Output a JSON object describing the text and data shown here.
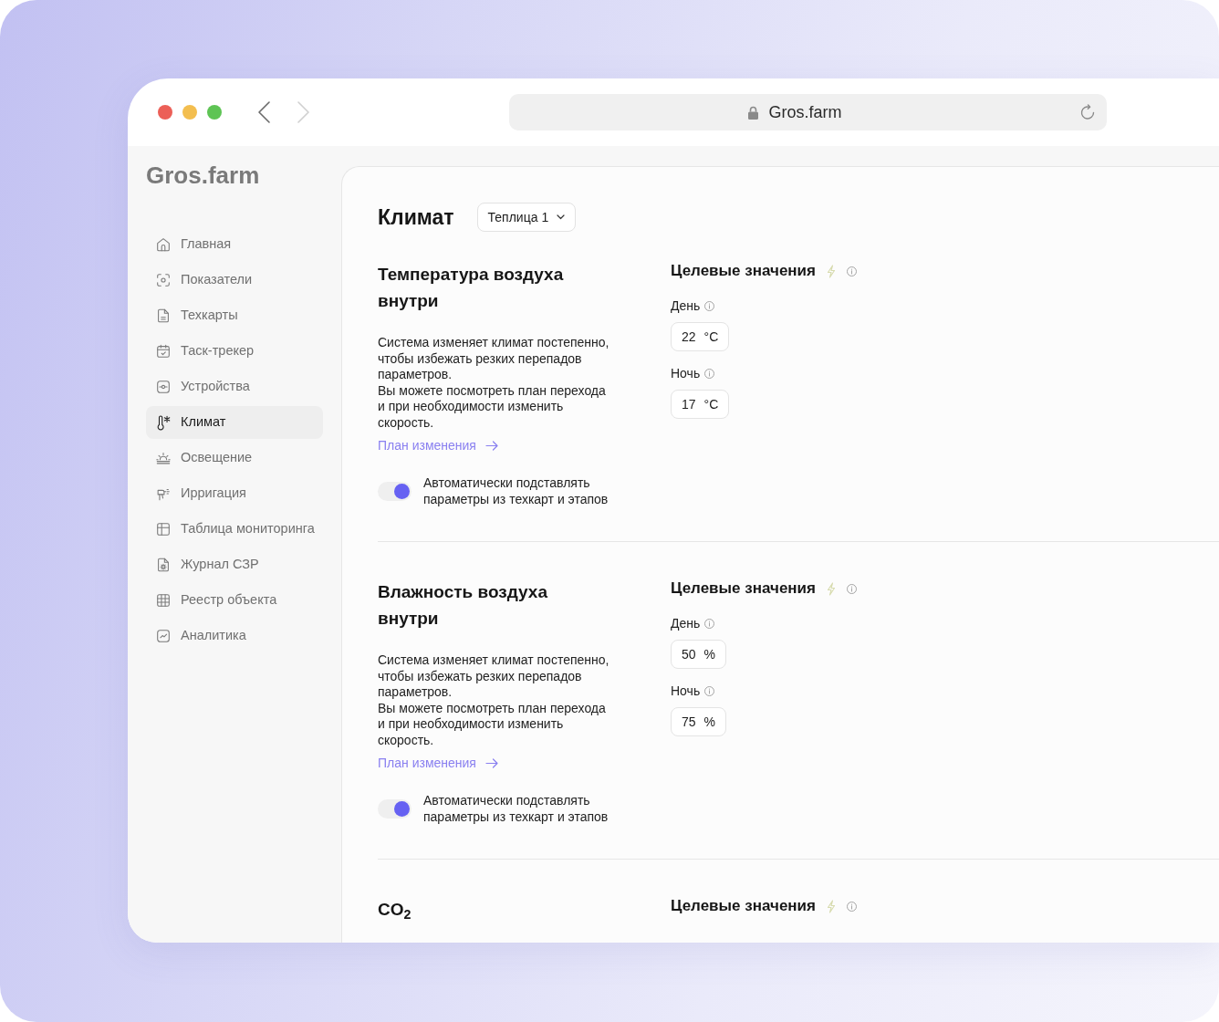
{
  "browser": {
    "navigation": [
      {
        "kind": "back",
        "disabled": false
      },
      {
        "kind": "forward",
        "disabled": true
      }
    ],
    "url": "Gros.farm"
  },
  "sidebar": {
    "logo": "Gros.farm",
    "items": [
      {
        "label": "Главная",
        "selected": false
      },
      {
        "label": "Показатели",
        "selected": false
      },
      {
        "label": "Техкарты",
        "selected": false
      },
      {
        "label": "Таск-трекер",
        "selected": false
      },
      {
        "label": "Устройства",
        "selected": false
      },
      {
        "label": "Климат",
        "selected": true
      },
      {
        "label": "Освещение",
        "selected": false
      },
      {
        "label": "Ирригация",
        "selected": false
      },
      {
        "label": "Таблица мониторинга",
        "selected": false
      },
      {
        "label": "Журнал СЗР",
        "selected": false
      },
      {
        "label": "Реестр объекта",
        "selected": false
      },
      {
        "label": "Аналитика",
        "selected": false
      }
    ]
  },
  "page": {
    "title": "Климат",
    "greenhouse": "Теплица 1"
  },
  "sections": [
    {
      "title": "Температура воздуха внутри",
      "description": [
        "Система изменяет климат постепенно, чтобы избежать резких перепадов параметров.",
        "Вы можете посмотреть план перехода и при необходимости изменить скорость."
      ],
      "link": "План изменения",
      "auto_fill": {
        "label": "Автоматически подставлять параметры из техкарт и этапов",
        "on": true
      },
      "targets": {
        "heading": "Целевые значения",
        "fields": [
          {
            "label": "День",
            "value": "22",
            "unit": "°C"
          },
          {
            "label": "Ночь",
            "value": "17",
            "unit": "°C"
          }
        ]
      }
    },
    {
      "title": "Влажность воздуха внутри",
      "description": [
        "Система изменяет климат постепенно, чтобы избежать резких перепадов параметров.",
        "Вы можете посмотреть план перехода и при необходимости изменить скорость."
      ],
      "link": "План изменения",
      "auto_fill": {
        "label": "Автоматически подставлять параметры из техкарт и этапов",
        "on": true
      },
      "targets": {
        "heading": "Целевые значения",
        "fields": [
          {
            "label": "День",
            "value": "50",
            "unit": "%"
          },
          {
            "label": "Ночь",
            "value": "75",
            "unit": "%"
          }
        ]
      }
    },
    {
      "title": "CO$_{2}$",
      "targets": {
        "heading": "Целевые значения"
      }
    }
  ]
}
